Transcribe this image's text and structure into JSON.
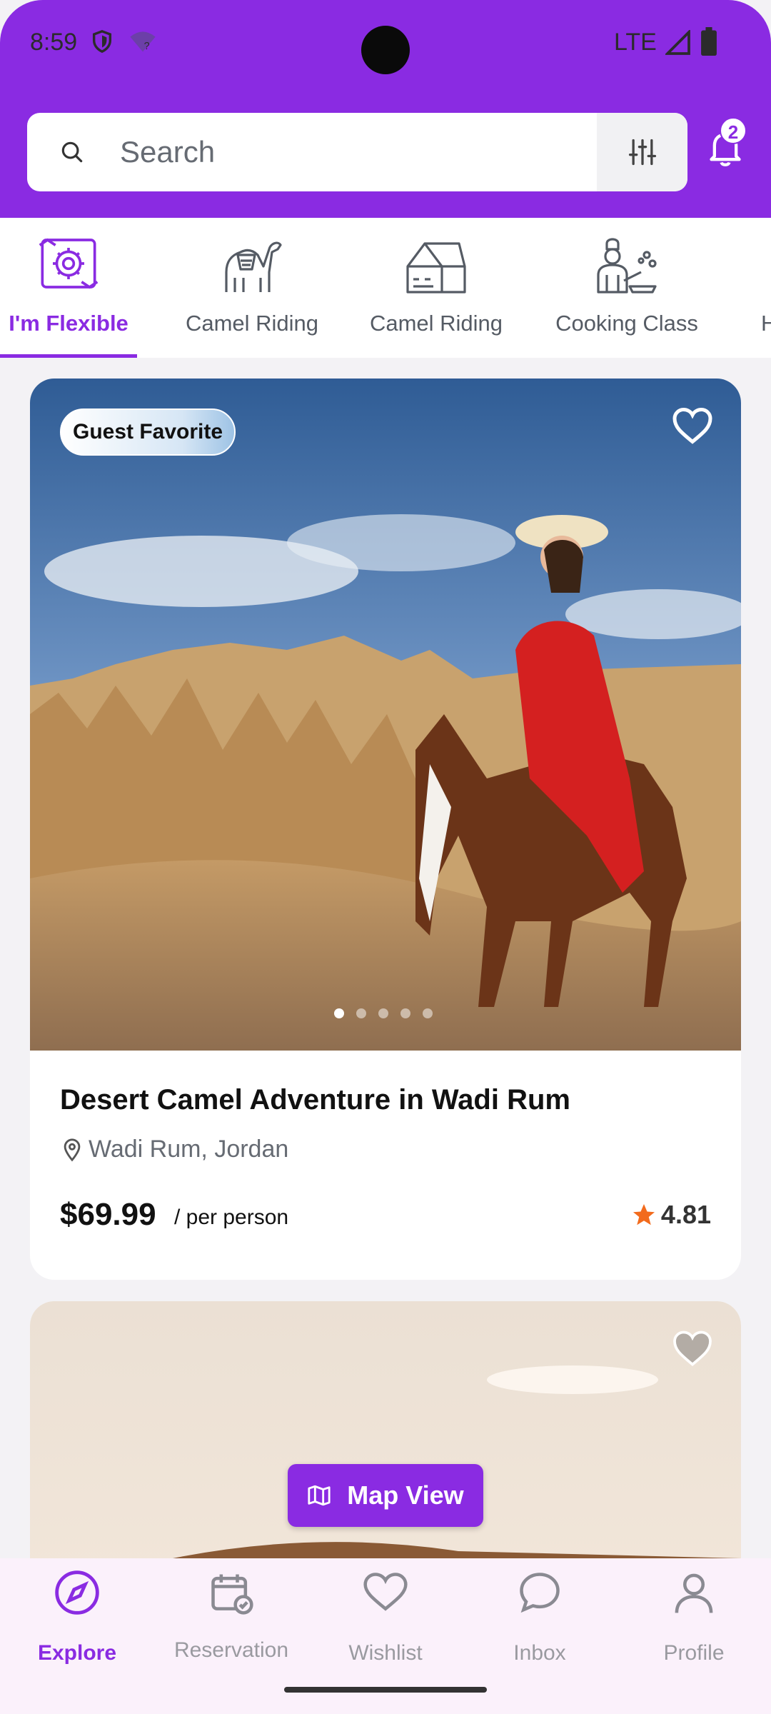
{
  "status_bar": {
    "time": "8:59",
    "network": "LTE"
  },
  "search": {
    "placeholder": "Search"
  },
  "notifications": {
    "count": "2"
  },
  "categories": [
    {
      "label": "I'm Flexible",
      "icon": "flexible-gear-icon",
      "active": true
    },
    {
      "label": "Camel Riding",
      "icon": "camel-icon"
    },
    {
      "label": "Camel Riding",
      "icon": "tent-icon"
    },
    {
      "label": "Cooking Class",
      "icon": "chef-icon"
    },
    {
      "label": "H",
      "icon": ""
    }
  ],
  "listings": [
    {
      "badge": "Guest Favorite",
      "title": "Desert Camel Adventure in Wadi Rum",
      "location": "Wadi Rum, Jordan",
      "price": "$69.99",
      "price_unit": "/ per person",
      "rating": "4.81",
      "image_count": 5,
      "active_image": 1
    }
  ],
  "map_button": {
    "label": "Map View"
  },
  "bottom_nav": [
    {
      "label": "Explore",
      "icon": "compass-icon",
      "active": true
    },
    {
      "label": "Reservation",
      "icon": "calendar-icon"
    },
    {
      "label": "Wishlist",
      "icon": "heart-icon"
    },
    {
      "label": "Inbox",
      "icon": "chat-icon"
    },
    {
      "label": "Profile",
      "icon": "person-icon"
    }
  ],
  "colors": {
    "brand": "#8a2be2",
    "star": "#f26b1d"
  }
}
